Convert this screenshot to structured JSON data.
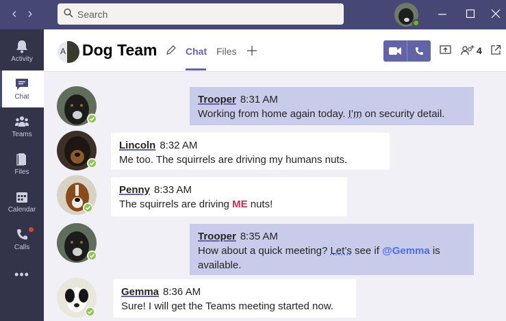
{
  "search": {
    "placeholder": "Search"
  },
  "rail": {
    "items": [
      {
        "label": "Activity",
        "icon": "bell-icon"
      },
      {
        "label": "Chat",
        "icon": "chat-icon"
      },
      {
        "label": "Teams",
        "icon": "teams-icon"
      },
      {
        "label": "Files",
        "icon": "file-icon"
      },
      {
        "label": "Calendar",
        "icon": "calendar-icon"
      },
      {
        "label": "Calls",
        "icon": "phone-icon"
      }
    ],
    "more": "•••"
  },
  "header": {
    "avatar_letter": "A",
    "title": "Dog Team",
    "tabs": [
      {
        "label": "Chat"
      },
      {
        "label": "Files"
      }
    ],
    "participants": "4"
  },
  "messages": [
    {
      "author": "Trooper",
      "time": "8:31 AM",
      "mine": true,
      "parts": [
        "Working from home again today. ",
        "I’m",
        " on security detail."
      ]
    },
    {
      "author": "Lincoln",
      "time": "8:32 AM",
      "mine": false,
      "text": "Me too. The squirrels are driving my humans nuts."
    },
    {
      "author": "Penny",
      "time": "8:33 AM",
      "mine": false,
      "parts": [
        "The squirrels are driving ",
        "ME",
        " nuts!"
      ]
    },
    {
      "author": "Trooper",
      "time": "8:35 AM",
      "mine": true,
      "parts": [
        "How about a quick meeting? ",
        "Let’s",
        " see if ",
        "@Gemma",
        " is available."
      ]
    },
    {
      "author": "Gemma",
      "time": "8:36 AM",
      "mine": false,
      "text": "Sure! I will get the Teams meeting started now."
    }
  ],
  "colors": {
    "titlebar": "#464775",
    "rail": "#33344a",
    "accent": "#6264a7",
    "bubble_mine": "#c9cbea",
    "bubble_other": "#ffffff",
    "presence": "#92c353",
    "mention": "#4f6bed",
    "emphasis": "#c4314b"
  }
}
